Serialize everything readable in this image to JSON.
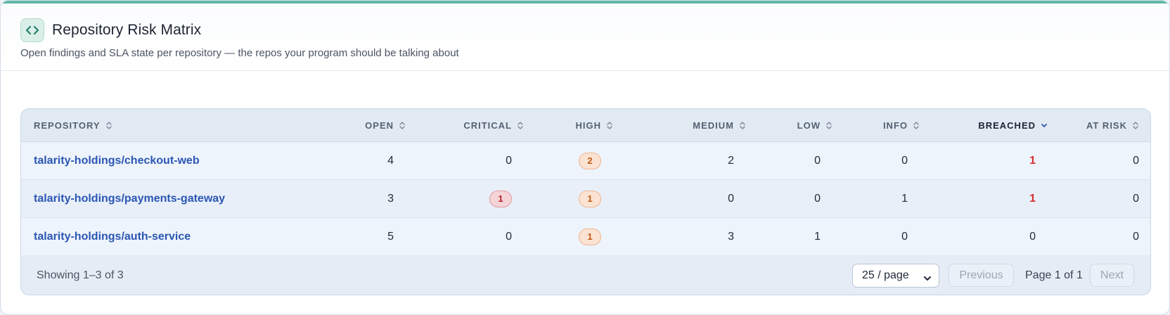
{
  "header": {
    "icon": "code-brackets-icon",
    "title": "Repository Risk Matrix",
    "subtitle": "Open findings and SLA state per repository — the repos your program should be talking about"
  },
  "colors": {
    "accent": "#5fb8a6",
    "link": "#2b56b3",
    "breached": "#d32f2f",
    "high_pill": "#c45a12",
    "critical_pill": "#b4202c"
  },
  "table": {
    "columns": {
      "repository": "REPOSITORY",
      "open": "OPEN",
      "critical": "CRITICAL",
      "high": "HIGH",
      "medium": "MEDIUM",
      "low": "LOW",
      "info": "INFO",
      "breached": "BREACHED",
      "at_risk": "AT RISK"
    },
    "sorted_column": "breached",
    "sort_direction": "descending",
    "rows": [
      {
        "repository": "talarity-holdings/checkout-web",
        "open": "4",
        "critical": "0",
        "high": "2",
        "medium": "2",
        "low": "0",
        "info": "0",
        "breached": "1",
        "at_risk": "0"
      },
      {
        "repository": "talarity-holdings/payments-gateway",
        "open": "3",
        "critical": "1",
        "high": "1",
        "medium": "0",
        "low": "0",
        "info": "1",
        "breached": "1",
        "at_risk": "0"
      },
      {
        "repository": "talarity-holdings/auth-service",
        "open": "5",
        "critical": "0",
        "high": "1",
        "medium": "3",
        "low": "1",
        "info": "0",
        "breached": "0",
        "at_risk": "0"
      }
    ]
  },
  "footer": {
    "showing": "Showing 1–3 of 3",
    "page_size": "25 / page",
    "previous_label": "Previous",
    "page_info": "Page 1 of 1",
    "next_label": "Next"
  }
}
